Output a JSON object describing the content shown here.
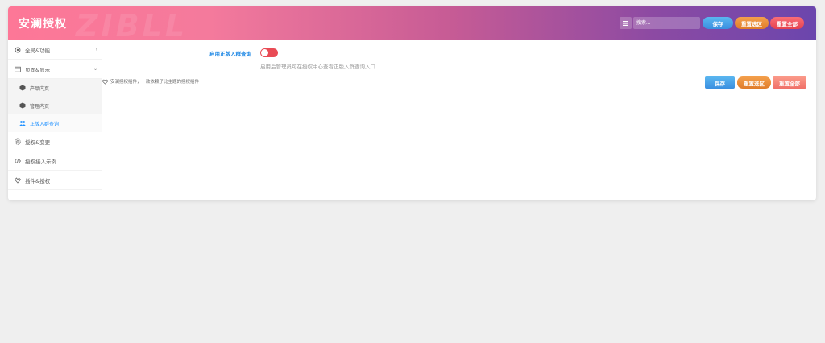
{
  "header": {
    "title": "安澜授权",
    "watermark": "ZIBLL",
    "search_placeholder": "搜索...",
    "buttons": {
      "save": "保存",
      "reset_section": "重置选区",
      "reset_all": "重置全部"
    }
  },
  "sidebar": {
    "items": [
      {
        "label": "全局&功能",
        "icon": "gear-icon",
        "arrow": "›"
      },
      {
        "label": "页面&显示",
        "icon": "calendar-icon",
        "arrow": "⌄",
        "children": [
          {
            "label": "产品内页",
            "icon": "cube-icon"
          },
          {
            "label": "管理内页",
            "icon": "cube-icon"
          },
          {
            "label": "正版入群查询",
            "icon": "users-icon",
            "active": true
          }
        ]
      },
      {
        "label": "授权&变更",
        "icon": "settings-icon"
      },
      {
        "label": "授权接入示例",
        "icon": "code-icon"
      },
      {
        "label": "插件&授权",
        "icon": "plugin-icon"
      }
    ]
  },
  "main": {
    "field": {
      "label": "启用正版入群查询",
      "toggle_on": false,
      "description": "启用后管理员可在授权中心查看正版入群查询入口"
    },
    "footer_note": "安澜授权插件，一款依赖子比主题的授权插件",
    "buttons": {
      "save": "保存",
      "reset_section": "重置选区",
      "reset_all": "重置全部"
    }
  },
  "colors": {
    "header_gradient_start": "#fd7797",
    "header_gradient_end": "#6b46ad",
    "accent_blue": "#1e88e5",
    "toggle_red": "#e94b55"
  }
}
